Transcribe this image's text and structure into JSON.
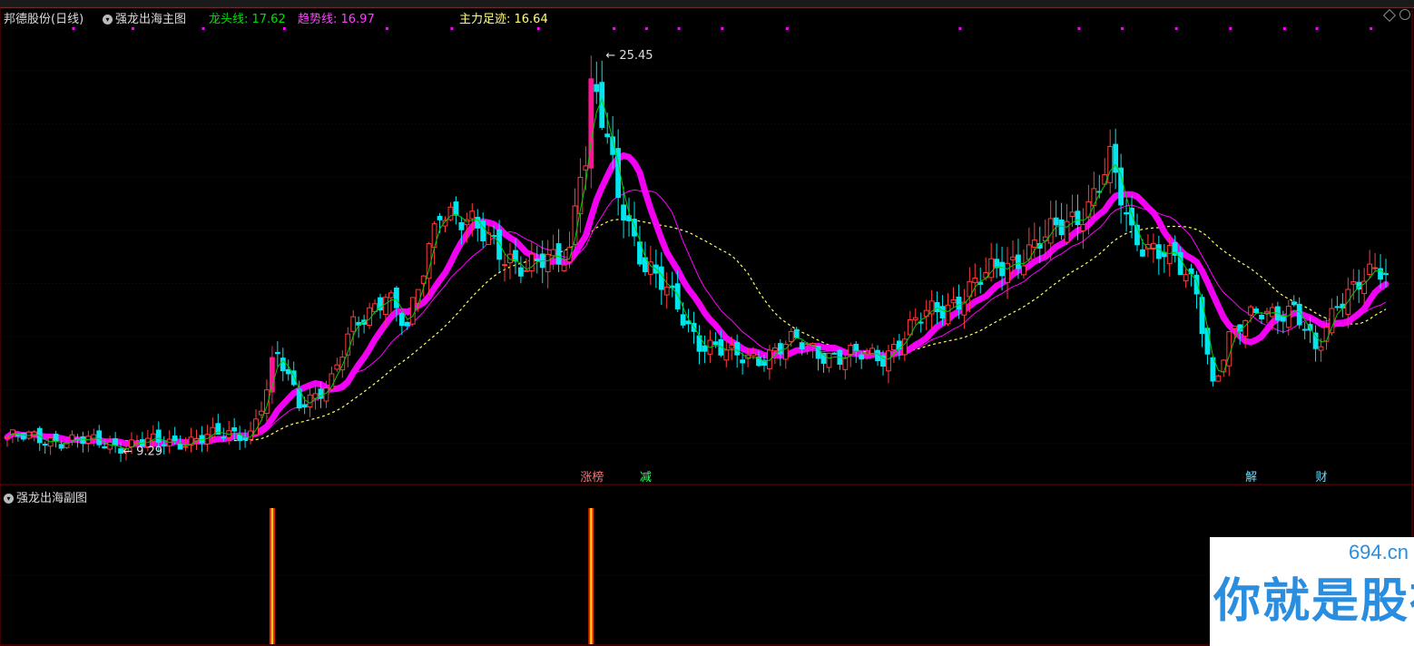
{
  "header": {
    "stock_name": "邦德股份(日线)",
    "indicator_name": "强龙出海主图",
    "dragon_label": "龙头线: 17.62",
    "trend_label": "趋势线: 16.97",
    "main_label": "主力足迹: 16.64"
  },
  "subchart": {
    "title": "强龙出海副图"
  },
  "watermark": {
    "url": "694.cn",
    "text": "你就是股神"
  },
  "colors": {
    "up": "#ff3b3b",
    "down": "#00e5ee",
    "dragon": "#00cc00",
    "trend": "#ff00ff",
    "main": "#ffff66",
    "limit": "#ff1493"
  },
  "chart_data": {
    "type": "candlestick",
    "price_range": [
      8.5,
      26.0
    ],
    "high_label": "25.45",
    "low_label": "9.29",
    "event_tags": [
      {
        "index": 107,
        "text": "涨榜"
      },
      {
        "index": 118,
        "text": "减"
      },
      {
        "index": 230,
        "text": "解"
      },
      {
        "index": 243,
        "text": "财"
      }
    ],
    "sub_bars_index": [
      49,
      108
    ],
    "close_anchors": [
      [
        0,
        9.6
      ],
      [
        10,
        9.5
      ],
      [
        20,
        9.3
      ],
      [
        30,
        9.4
      ],
      [
        45,
        9.8
      ],
      [
        48,
        11.5
      ],
      [
        50,
        12.8
      ],
      [
        54,
        11.0
      ],
      [
        60,
        11.8
      ],
      [
        64,
        14.0
      ],
      [
        70,
        15.5
      ],
      [
        74,
        13.8
      ],
      [
        80,
        19.0
      ],
      [
        84,
        18.2
      ],
      [
        90,
        17.5
      ],
      [
        96,
        16.2
      ],
      [
        104,
        17.2
      ],
      [
        108,
        24.0
      ],
      [
        113,
        19.5
      ],
      [
        118,
        16.5
      ],
      [
        124,
        14.8
      ],
      [
        128,
        13.5
      ],
      [
        134,
        12.8
      ],
      [
        140,
        12.9
      ],
      [
        146,
        13.4
      ],
      [
        154,
        12.8
      ],
      [
        162,
        12.9
      ],
      [
        170,
        14.5
      ],
      [
        176,
        15.2
      ],
      [
        184,
        16.5
      ],
      [
        192,
        17.5
      ],
      [
        200,
        19.0
      ],
      [
        204,
        20.5
      ],
      [
        208,
        17.8
      ],
      [
        214,
        17.0
      ],
      [
        220,
        15.5
      ],
      [
        223,
        11.8
      ],
      [
        226,
        13.5
      ],
      [
        232,
        14.8
      ],
      [
        238,
        14.6
      ],
      [
        242,
        13.0
      ],
      [
        246,
        15.2
      ],
      [
        254,
        16.2
      ]
    ]
  }
}
